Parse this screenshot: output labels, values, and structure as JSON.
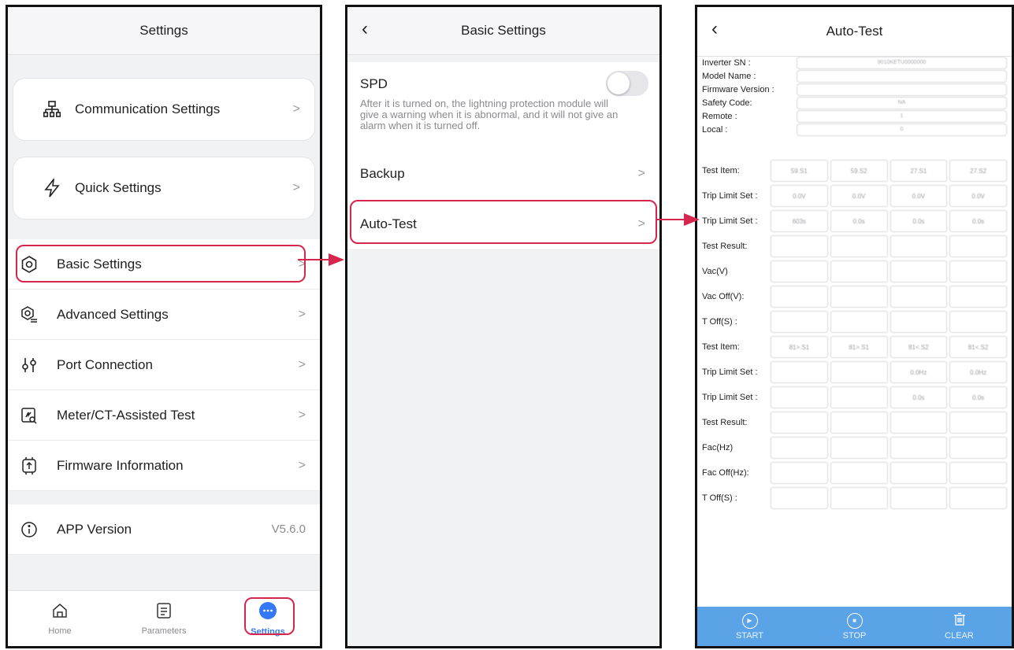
{
  "screen1": {
    "title": "Settings",
    "cards": [
      {
        "label": "Communication Settings",
        "icon": "network-icon"
      },
      {
        "label": "Quick Settings",
        "icon": "lightning-icon"
      }
    ],
    "items": [
      {
        "label": "Basic Settings",
        "icon": "gear-icon"
      },
      {
        "label": "Advanced Settings",
        "icon": "gear-list-icon"
      },
      {
        "label": "Port Connection",
        "icon": "port-icon"
      },
      {
        "label": "Meter/CT-Assisted Test",
        "icon": "meter-search-icon"
      },
      {
        "label": "Firmware Information",
        "icon": "chip-upload-icon"
      }
    ],
    "version": {
      "label": "APP Version",
      "value": "V5.6.0"
    },
    "tabs": [
      {
        "label": "Home",
        "icon": "home-icon"
      },
      {
        "label": "Parameters",
        "icon": "document-icon"
      },
      {
        "label": "Settings",
        "icon": "more-dots-icon"
      }
    ],
    "highlight_color": "#d6264d",
    "active_color": "#3478f6"
  },
  "screen2": {
    "title": "Basic Settings",
    "spd": {
      "title": "SPD",
      "description": "After it is turned on, the lightning protection module will give a warning when it is abnormal, and it will not give an alarm when it is turned off."
    },
    "rows": [
      {
        "label": "Backup"
      },
      {
        "label": "Auto-Test"
      }
    ]
  },
  "screen3": {
    "title": "Auto-Test",
    "info": [
      {
        "label": "Inverter SN :",
        "value": "9010KETU0000000"
      },
      {
        "label": "Model Name :",
        "value": ""
      },
      {
        "label": "Firmware Version :",
        "value": ""
      },
      {
        "label": "Safety Code:",
        "value": "NA"
      },
      {
        "label": "Remote :",
        "value": "1"
      },
      {
        "label": "Local :",
        "value": "0"
      }
    ],
    "table": [
      {
        "label": "Test Item:",
        "cells": [
          "59.S1",
          "59.S2",
          "27.S1",
          "27.S2"
        ]
      },
      {
        "label": "Trip Limit Set :",
        "cells": [
          "0.0V",
          "0.0V",
          "0.0V",
          "0.0V"
        ]
      },
      {
        "label": "Trip Limit Set :",
        "cells": [
          "603s",
          "0.0s",
          "0.0s",
          "0.0s"
        ]
      },
      {
        "label": "Test Result:",
        "cells": [
          "",
          "",
          "",
          ""
        ]
      },
      {
        "label": "Vac(V)",
        "cells": [
          "",
          "",
          "",
          ""
        ]
      },
      {
        "label": "Vac Off(V):",
        "cells": [
          "",
          "",
          "",
          ""
        ]
      },
      {
        "label": "T Off(S) :",
        "cells": [
          "",
          "",
          "",
          ""
        ]
      },
      {
        "label": "Test Item:",
        "cells": [
          "81>.S1",
          "81>.S1",
          "81<.S2",
          "81<.S2"
        ]
      },
      {
        "label": "Trip Limit Set :",
        "cells": [
          "",
          "",
          "0.0Hz",
          "0.0Hz"
        ]
      },
      {
        "label": "Trip Limit Set :",
        "cells": [
          "",
          "",
          "0.0s",
          "0.0s"
        ]
      },
      {
        "label": "Test Result:",
        "cells": [
          "",
          "",
          "",
          ""
        ]
      },
      {
        "label": "Fac(Hz)",
        "cells": [
          "",
          "",
          "",
          ""
        ]
      },
      {
        "label": "Fac Off(Hz):",
        "cells": [
          "",
          "",
          "",
          ""
        ]
      },
      {
        "label": "T Off(S) :",
        "cells": [
          "",
          "",
          "",
          ""
        ]
      }
    ],
    "toolbar": [
      {
        "label": "START",
        "icon": "play-icon"
      },
      {
        "label": "STOP",
        "icon": "stop-icon"
      },
      {
        "label": "CLEAR",
        "icon": "trash-icon"
      }
    ],
    "toolbar_color": "#5aa3e6"
  }
}
